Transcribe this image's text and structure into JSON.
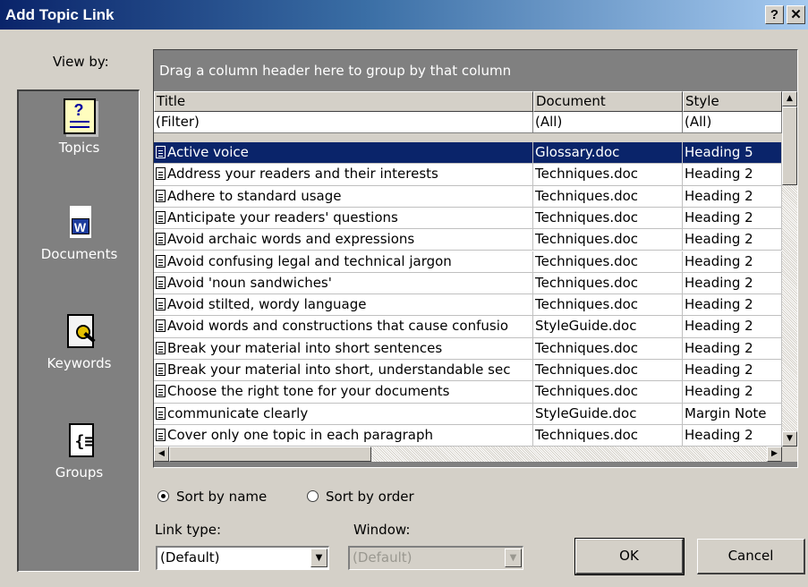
{
  "window": {
    "title": "Add Topic Link",
    "help_glyph": "?",
    "close_glyph": "✕"
  },
  "sidebar": {
    "label": "View by:",
    "items": [
      {
        "label": "Topics",
        "icon": "topics-icon",
        "selected": true
      },
      {
        "label": "Documents",
        "icon": "documents-icon",
        "selected": false
      },
      {
        "label": "Keywords",
        "icon": "keywords-icon",
        "selected": false
      },
      {
        "label": "Groups",
        "icon": "groups-icon",
        "selected": false
      }
    ],
    "icon_glyphs": {
      "topics": "?",
      "documents": "W",
      "groups": "{≡"
    }
  },
  "grid": {
    "group_by_hint": "Drag a column header here to group by that column",
    "columns": [
      "Title",
      "Document",
      "Style"
    ],
    "filter": [
      "(Filter)",
      "(All)",
      "(All)"
    ],
    "rows": [
      [
        "Active voice",
        "Glossary.doc",
        "Heading 5"
      ],
      [
        "Address your readers and their interests",
        "Techniques.doc",
        "Heading 2"
      ],
      [
        "Adhere to standard usage",
        "Techniques.doc",
        "Heading 2"
      ],
      [
        "Anticipate your readers' questions",
        "Techniques.doc",
        "Heading 2"
      ],
      [
        "Avoid archaic words and expressions",
        "Techniques.doc",
        "Heading 2"
      ],
      [
        "Avoid confusing legal and technical jargon",
        "Techniques.doc",
        "Heading 2"
      ],
      [
        "Avoid 'noun sandwiches'",
        "Techniques.doc",
        "Heading 2"
      ],
      [
        "Avoid stilted, wordy language",
        "Techniques.doc",
        "Heading 2"
      ],
      [
        "Avoid words and constructions that cause confusio",
        "StyleGuide.doc",
        "Heading 2"
      ],
      [
        "Break your material into short sentences",
        "Techniques.doc",
        "Heading 2"
      ],
      [
        "Break your material into short, understandable sec",
        "Techniques.doc",
        "Heading 2"
      ],
      [
        "Choose the right tone for your documents",
        "Techniques.doc",
        "Heading 2"
      ],
      [
        "communicate clearly",
        "StyleGuide.doc",
        "Margin Note"
      ],
      [
        "Cover only one topic in each paragraph",
        "Techniques.doc",
        "Heading 2"
      ]
    ],
    "selected_row": 0
  },
  "sort": {
    "by_name_label": "Sort by name",
    "by_order_label": "Sort by order",
    "selected": "name"
  },
  "link_type": {
    "label": "Link type:",
    "value": "(Default)"
  },
  "window_field": {
    "label": "Window:",
    "value": "(Default)",
    "disabled": true
  },
  "buttons": {
    "ok": "OK",
    "cancel": "Cancel"
  },
  "scroll_glyphs": {
    "up": "▲",
    "down": "▼",
    "left": "◀",
    "right": "▶"
  },
  "colors": {
    "titlebar": "#0a246a",
    "selection": "#0a246a",
    "face": "#d4d0c8",
    "panel": "#808080"
  }
}
